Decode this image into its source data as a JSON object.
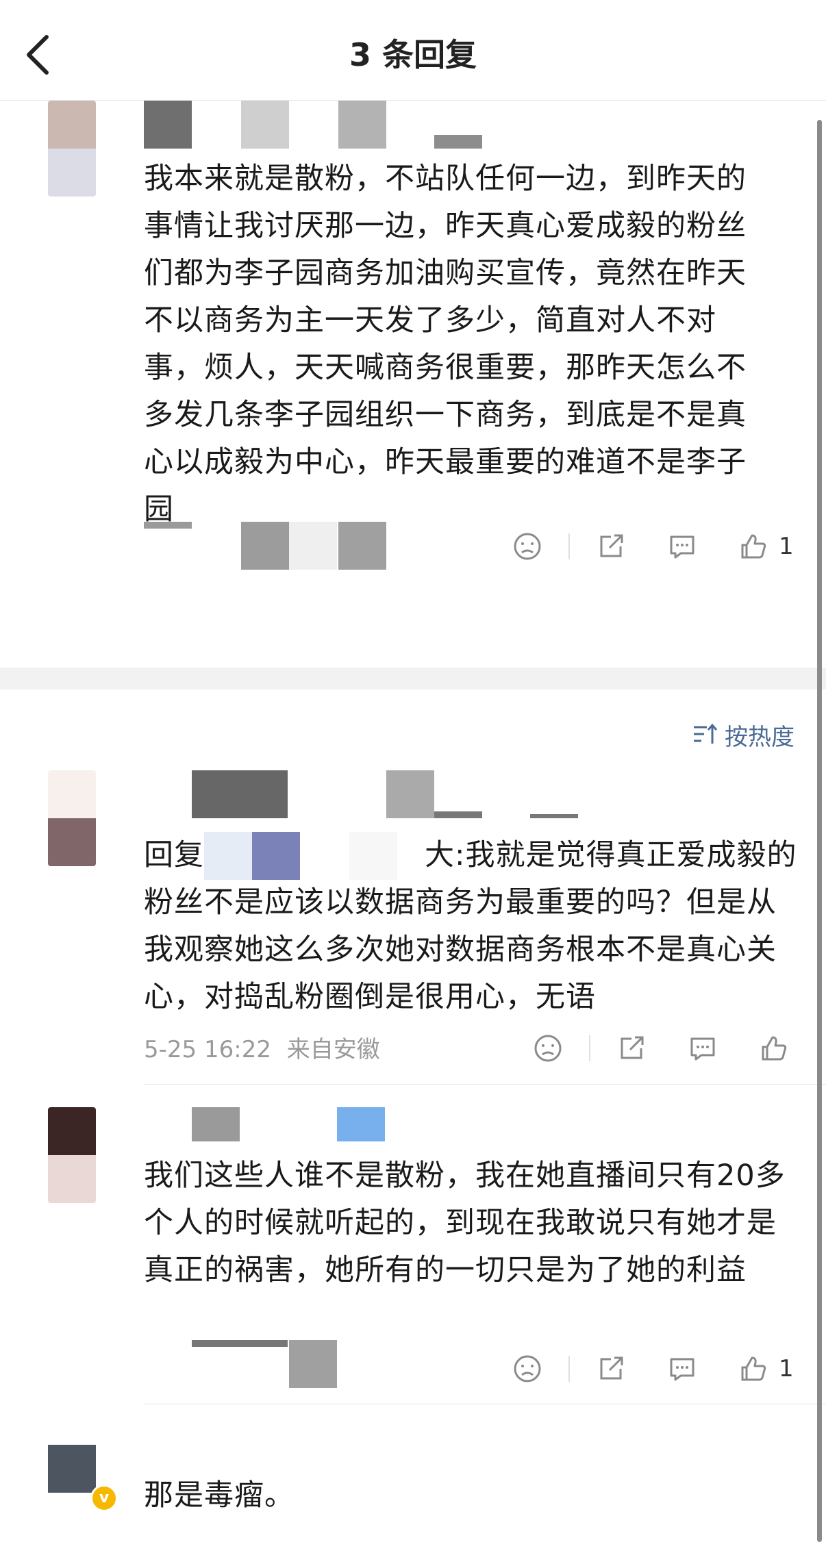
{
  "header": {
    "title": "3 条回复"
  },
  "root_comment": {
    "text": "我本来就是散粉，不站队任何一边，到昨天的事情让我讨厌那一边，昨天真心爱成毅的粉丝们都为李子园商务加油购买宣传，竟然在昨天不以商务为主一天发了多少，简直对人不对事，烦人，天天喊商务很重要，那昨天怎么不多发几条李子园组织一下商务，到底是不是真心以成毅为中心，昨天最重要的难道不是李子园",
    "likes": "1"
  },
  "sort": {
    "label": "按热度"
  },
  "replies": [
    {
      "reply_prefix": "回复",
      "text_after_name": "大:我就是觉得真正爱成毅的粉丝不是应该以数据商务为最重要的吗？但是从我观察她这么多次她对数据商务根本不是真心关心，对捣乱粉圈倒是很用心，无语",
      "time": "5-25 16:22",
      "location": "来自安徽",
      "likes": ""
    },
    {
      "text": "我们这些人谁不是散粉，我在她直播间只有20多个人的时候就听起的，到现在我敢说只有她才是真正的祸害，她所有的一切只是为了她的利益",
      "likes": "1"
    },
    {
      "text": "那是毒瘤。",
      "badge": "v"
    }
  ],
  "icons": [
    "back-icon",
    "dislike-icon",
    "share-icon",
    "comment-icon",
    "like-icon",
    "sort-icon",
    "verified-icon"
  ],
  "colors": {
    "sort_accent": "#4a6b95",
    "meta_gray": "#9a9a9a",
    "badge": "#f6b800"
  }
}
